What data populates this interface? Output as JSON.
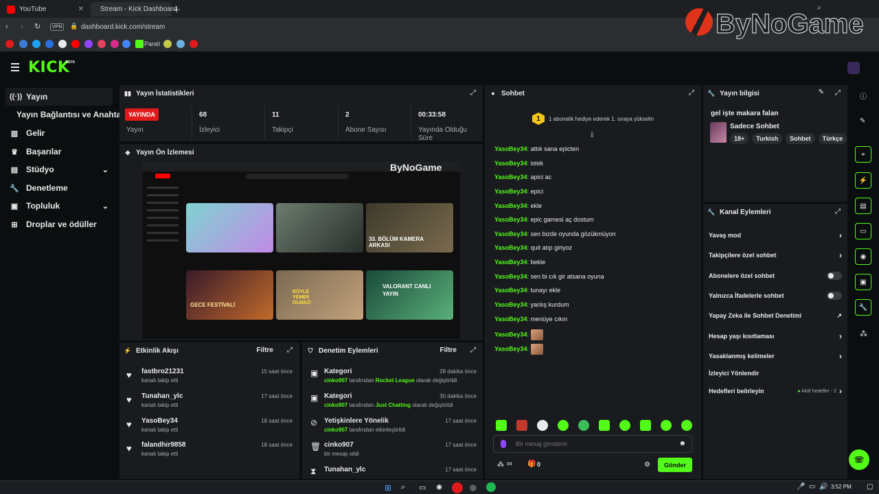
{
  "browser": {
    "tabs": [
      {
        "title": "YouTube",
        "active": false
      },
      {
        "title": "Stream - Kick Dashboard",
        "active": true
      }
    ],
    "url": "dashboard.kick.com/stream",
    "vpn_label": "VPN",
    "bookmark_panel_label": "Panel"
  },
  "overlay_logo": {
    "text": "ByNoGame"
  },
  "kick": {
    "logo_text": "KICK",
    "logo_badge": "BETA"
  },
  "nav": {
    "items": [
      {
        "label": "Yayın",
        "icon": "broadcast-icon",
        "active": true
      },
      {
        "label": "Yayın Bağlantısı ve Anahtarı",
        "icon": "",
        "active": false
      },
      {
        "label": "Gelir",
        "icon": "revenue-icon",
        "active": false
      },
      {
        "label": "Başarılar",
        "icon": "trophy-icon",
        "active": false
      },
      {
        "label": "Stüdyo",
        "icon": "studio-icon",
        "active": false,
        "expand": true
      },
      {
        "label": "Denetleme",
        "icon": "wrench-icon",
        "active": false
      },
      {
        "label": "Topluluk",
        "icon": "community-icon",
        "active": false,
        "expand": true
      },
      {
        "label": "Droplar ve ödüller",
        "icon": "gift-icon",
        "active": false
      }
    ]
  },
  "stats": {
    "title": "Yayın İstatistikleri",
    "items": [
      {
        "value": "YAYINDA",
        "label": "Yayın"
      },
      {
        "value": "68",
        "label": "İzleyici"
      },
      {
        "value": "11",
        "label": "Takipçi"
      },
      {
        "value": "2",
        "label": "Abone Sayısı"
      },
      {
        "value": "00:33:58",
        "label": "Yayında Olduğu Süre"
      }
    ]
  },
  "preview": {
    "title": "Yayın Ön İzlemesi",
    "thumb_texts": [
      "33. BÖLÜM KAMERA ARKASI",
      "GECE FESTİVALİ",
      "BÖYLE YEMEK OLMAZ!",
      "VALORANT CANLI YAYIN"
    ]
  },
  "activity": {
    "title": "Etkinlik Akışı",
    "filter_label": "Filtre",
    "items": [
      {
        "name": "fastbro21231",
        "sub": "kanalı takip etti",
        "time": "15 saat önce"
      },
      {
        "name": "Tunahan_ylc",
        "sub": "kanalı takip etti",
        "time": "17 saat önce"
      },
      {
        "name": "YasoBey34",
        "sub": "kanalı takip etti",
        "time": "18 saat önce"
      },
      {
        "name": "falandhir9858",
        "sub": "kanalı takip etti",
        "time": "18 saat önce"
      }
    ]
  },
  "moderation": {
    "title": "Denetim Eylemleri",
    "filter_label": "Filtre",
    "items": [
      {
        "name": "Kategori",
        "actor": "cinko907",
        "mid": "tarafından",
        "target": "Rocket League",
        "tail": "olarak değiştirildi",
        "time": "28 dakika önce",
        "icon": "category-icon"
      },
      {
        "name": "Kategori",
        "actor": "cinko907",
        "mid": "tarafından",
        "target": "Just Chatting",
        "tail": "olarak değiştirildi",
        "time": "30 dakika önce",
        "icon": "category-icon"
      },
      {
        "name": "Yetişkinlere Yönelik",
        "actor": "cinko907",
        "mid": "tarafından etkinleştirildi",
        "target": "",
        "tail": "",
        "time": "17 saat önce",
        "icon": "eye-off-icon"
      },
      {
        "name": "cinko907",
        "actor": "",
        "mid": "bir mesajı sildi",
        "target": "",
        "tail": "",
        "time": "17 saat önce",
        "icon": "trash-icon"
      },
      {
        "name": "Tunahan_ylc",
        "actor": "",
        "mid": "",
        "target": "",
        "tail": "",
        "time": "17 saat önce",
        "icon": "hourglass-icon"
      }
    ]
  },
  "chat": {
    "title": "Sohbet",
    "gift_badge": "1",
    "gift_text": "1 abonelik hediye ederek 1. sıraya yükselin",
    "messages": [
      {
        "user": "YasoBey34",
        "text": "attık sana epicten"
      },
      {
        "user": "YasoBey34",
        "text": "istek"
      },
      {
        "user": "YasoBey34",
        "text": "apici ac"
      },
      {
        "user": "YasoBey34",
        "text": "epici"
      },
      {
        "user": "YasoBey34",
        "text": "ekle"
      },
      {
        "user": "YasoBey34",
        "text": "epic gamesi aç dostum"
      },
      {
        "user": "YasoBey34",
        "text": "sen bizde oyunda gözükmüyon"
      },
      {
        "user": "YasoBey34",
        "text": "quit atıp giriyoz"
      },
      {
        "user": "YasoBey34",
        "text": "bekle"
      },
      {
        "user": "YasoBey34",
        "text": "sen bi cık gir atsana oyuna"
      },
      {
        "user": "YasoBey34",
        "text": "tunayı ekle"
      },
      {
        "user": "YasoBey34",
        "text": "yanlış kurdum"
      },
      {
        "user": "YasoBey34",
        "text": "menüye cıkın"
      },
      {
        "user": "YasoBey34",
        "text": ""
      },
      {
        "user": "YasoBey34",
        "text": ""
      }
    ],
    "input_placeholder": "Bir mesaj gönderin",
    "points": "∞",
    "gift_count": "0",
    "send_label": "Gönder"
  },
  "stream_info": {
    "title": "Yayın bilgisi",
    "stream_title": "gel işte makara falan",
    "category": "Sadece Sohbet",
    "tags": [
      "18+",
      "Turkish",
      "Sohbet",
      "Türkçe"
    ]
  },
  "channel_actions": {
    "title": "Kanal Eylemleri",
    "items": [
      {
        "label": "Yavaş mod",
        "control": "chevron"
      },
      {
        "label": "Takipçilere özel sohbet",
        "control": "chevron"
      },
      {
        "label": "Abonelere özel sohbet",
        "control": "toggle"
      },
      {
        "label": "Yalnızca İfadelerle sohbet",
        "control": "toggle"
      },
      {
        "label": "Yapay Zeka ile Sohbet Denetimi",
        "control": "external"
      },
      {
        "label": "Hesap yaşı kısıtlaması",
        "control": "chevron"
      },
      {
        "label": "Yasaklanmış kelimeler",
        "control": "chevron"
      },
      {
        "label": "İzleyici Yönlendir",
        "control": "none"
      },
      {
        "label": "Hedefleri belirleyin",
        "control": "chevron",
        "extra": "Aktif hedefler - 2"
      }
    ]
  },
  "taskbar": {
    "time": "3:52 PM"
  },
  "colors": {
    "kick_green": "#53fc18",
    "live_red": "#e01a1a",
    "panel_bg": "#191b1f",
    "page_bg": "#0b0e0f"
  }
}
